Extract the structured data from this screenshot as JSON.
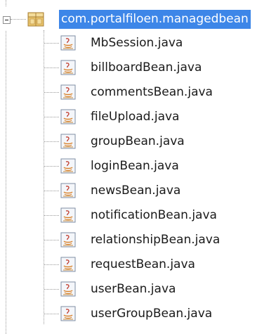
{
  "tree": {
    "package": {
      "label": "com.portalfiloen.managedbean",
      "icon": "java-package-icon",
      "expanded": true,
      "selected": true,
      "selection_color": "#3d86e8"
    },
    "files": [
      {
        "label": "MbSession.java",
        "icon": "java-class-file-icon"
      },
      {
        "label": "billboardBean.java",
        "icon": "java-class-file-icon"
      },
      {
        "label": "commentsBean.java",
        "icon": "java-class-file-icon"
      },
      {
        "label": "fileUpload.java",
        "icon": "java-class-file-icon"
      },
      {
        "label": "groupBean.java",
        "icon": "java-class-file-icon"
      },
      {
        "label": "loginBean.java",
        "icon": "java-class-file-icon"
      },
      {
        "label": "newsBean.java",
        "icon": "java-class-file-icon"
      },
      {
        "label": "notificationBean.java",
        "icon": "java-class-file-icon"
      },
      {
        "label": "relationshipBean.java",
        "icon": "java-class-file-icon"
      },
      {
        "label": "requestBean.java",
        "icon": "java-class-file-icon"
      },
      {
        "label": "userBean.java",
        "icon": "java-class-file-icon"
      },
      {
        "label": "userGroupBean.java",
        "icon": "java-class-file-icon"
      }
    ]
  }
}
